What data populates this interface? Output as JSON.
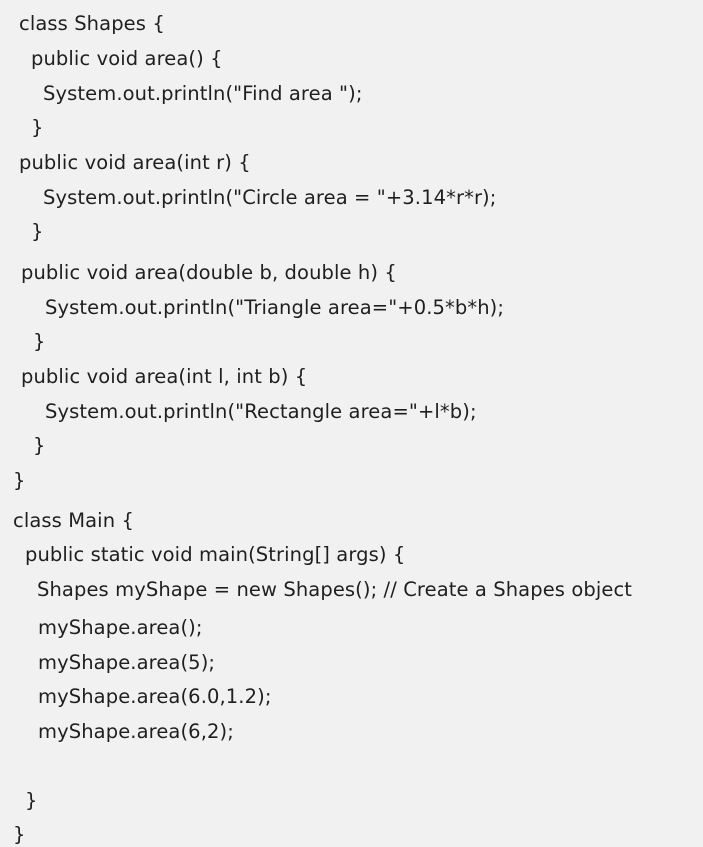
{
  "code_lines": [
    "class Shapes {",
    "public void area() {",
    "System.out.println(\"Find area \");",
    "}",
    "public void area(int r) {",
    "System.out.println(\"Circle area = \"+3.14*r*r);",
    "}",
    "public void area(double b, double h) {",
    "System.out.println(\"Triangle area=\"+0.5*b*h);",
    "}",
    "public void area(int l, int b) {",
    "System.out.println(\"Rectangle area=\"+l*b);",
    "}",
    "}",
    "class Main {",
    "public static void main(String[] args) {",
    "Shapes myShape = new Shapes(); // Create a Shapes object",
    "myShape.area();",
    "myShape.area(5);",
    "myShape.area(6.0,1.2);",
    "myShape.area(6,2);",
    "}",
    "}"
  ]
}
